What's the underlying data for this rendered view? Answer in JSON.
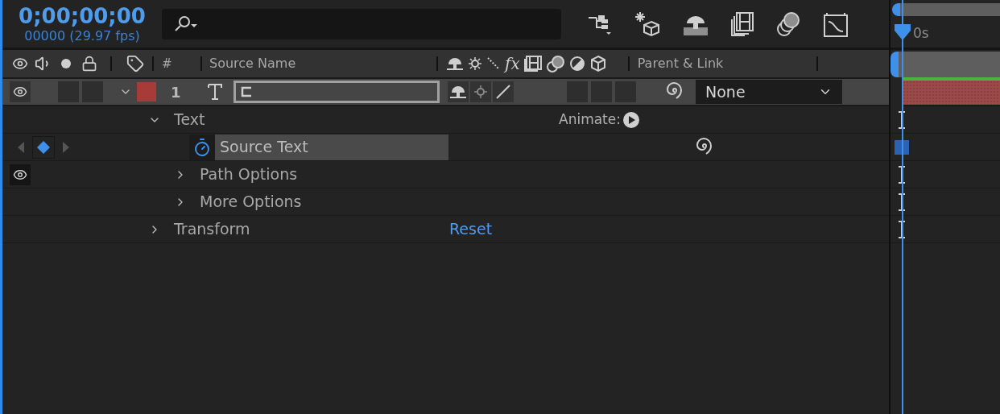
{
  "timecode": "0;00;00;00",
  "frame_info": "00000 (29.97 fps)",
  "columns": {
    "effects": "fx",
    "number": "#",
    "source_name": "Source Name",
    "parent": "Parent & Link"
  },
  "layer": {
    "number": "1",
    "color": "#a63b39",
    "visible": true,
    "expanded": true,
    "parent": "None"
  },
  "properties": [
    {
      "label": "Text",
      "expanded": true,
      "action": "Animate:",
      "children": [
        {
          "label": "Source Text",
          "kind": "keyframed"
        },
        {
          "label": "Path Options",
          "kind": "group",
          "expanded": false,
          "visible": true
        },
        {
          "label": "More Options",
          "kind": "group",
          "expanded": false
        }
      ]
    },
    {
      "label": "Transform",
      "expanded": false,
      "action_link": "Reset"
    }
  ],
  "timeline": {
    "time_label": "0s"
  }
}
